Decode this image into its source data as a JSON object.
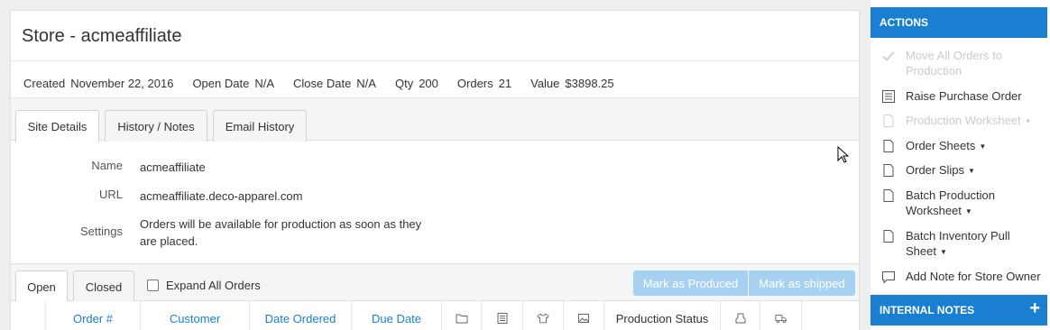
{
  "store": {
    "title": "Store - acmeaffiliate",
    "stats": [
      {
        "label": "Created",
        "value": "November 22, 2016"
      },
      {
        "label": "Open Date",
        "value": "N/A"
      },
      {
        "label": "Close Date",
        "value": "N/A"
      },
      {
        "label": "Qty",
        "value": "200"
      },
      {
        "label": "Orders",
        "value": "21"
      },
      {
        "label": "Value",
        "value": "$3898.25"
      }
    ]
  },
  "tabs": [
    "Site Details",
    "History / Notes",
    "Email History"
  ],
  "site_details": {
    "name_label": "Name",
    "name_value": "acmeaffiliate",
    "url_label": "URL",
    "url_value": "acmeaffiliate.deco-apparel.com",
    "settings_label": "Settings",
    "settings_value": "Orders will be available for production as soon as they are placed."
  },
  "orders_tabs": [
    "Open",
    "Closed"
  ],
  "expand_all_label": "Expand All Orders",
  "buttons": {
    "mark_produced": "Mark as Produced",
    "mark_shipped": "Mark as shipped"
  },
  "table_headers": {
    "order": "Order #",
    "customer": "Customer",
    "date_ordered": "Date Ordered",
    "due_date": "Due Date",
    "production_status": "Production Status"
  },
  "table_icons": [
    "folder-icon",
    "document-icon",
    "shirt-icon",
    "image-icon",
    "stamp-icon",
    "truck-icon"
  ],
  "sidebar": {
    "actions_title": "ACTIONS",
    "actions": [
      {
        "label": "Move All Orders to Production",
        "icon": "check-icon",
        "disabled": true
      },
      {
        "label": "Raise Purchase Order",
        "icon": "list-icon",
        "disabled": false
      },
      {
        "label": "Production Worksheet",
        "icon": "file-icon",
        "disabled": true,
        "caret": true
      },
      {
        "label": "Order Sheets",
        "icon": "file-icon",
        "disabled": false,
        "caret": true
      },
      {
        "label": "Order Slips",
        "icon": "file-icon",
        "disabled": false,
        "caret": true
      },
      {
        "label": "Batch Production Worksheet",
        "icon": "file-icon",
        "disabled": false,
        "caret": true
      },
      {
        "label": "Batch Inventory Pull Sheet",
        "icon": "file-icon",
        "disabled": false,
        "caret": true
      },
      {
        "label": "Add Note for Store Owner",
        "icon": "comment-icon",
        "disabled": false
      }
    ],
    "internal_notes_title": "INTERNAL NOTES",
    "add_icon": "plus-icon"
  },
  "colors": {
    "accent": "#1a7fd0",
    "button_disabled": "#a6d1f1",
    "disabled_text": "#c8cbcf"
  }
}
